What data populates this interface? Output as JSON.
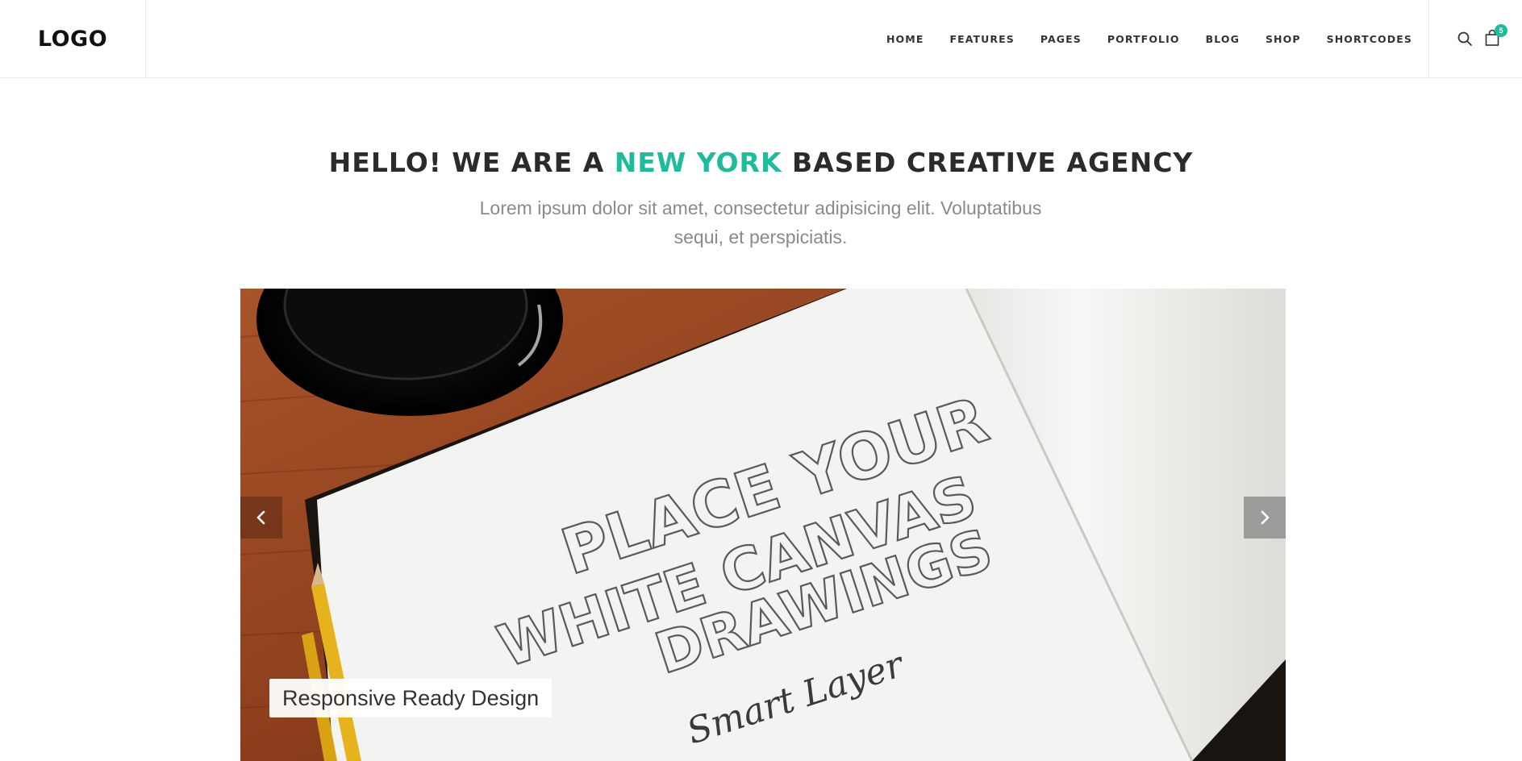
{
  "header": {
    "logo": "LOGO",
    "nav": [
      "HOME",
      "FEATURES",
      "PAGES",
      "PORTFOLIO",
      "BLOG",
      "SHOP",
      "SHORTCODES"
    ],
    "cart_count": "5"
  },
  "intro": {
    "headline_before": "HELLO! WE ARE A ",
    "headline_accent": "NEW YORK",
    "headline_after": " BASED CREATIVE AGENCY",
    "subtitle": "Lorem ipsum dolor sit amet, consectetur adipisicing elit. Voluptatibus sequi, et perspiciatis."
  },
  "slider": {
    "sketch_lines": [
      "PLACE YOUR",
      "WHITE CANVAS",
      "DRAWINGS"
    ],
    "sketch_signature": "Smart Layer",
    "caption": "Responsive Ready Design"
  },
  "colors": {
    "accent": "#1ebc9c",
    "text_dark": "#2b2b2b",
    "text_muted": "#8a8a8a"
  },
  "icons": [
    "search-icon",
    "shopping-bag-icon",
    "chevron-left-icon",
    "chevron-right-icon"
  ]
}
